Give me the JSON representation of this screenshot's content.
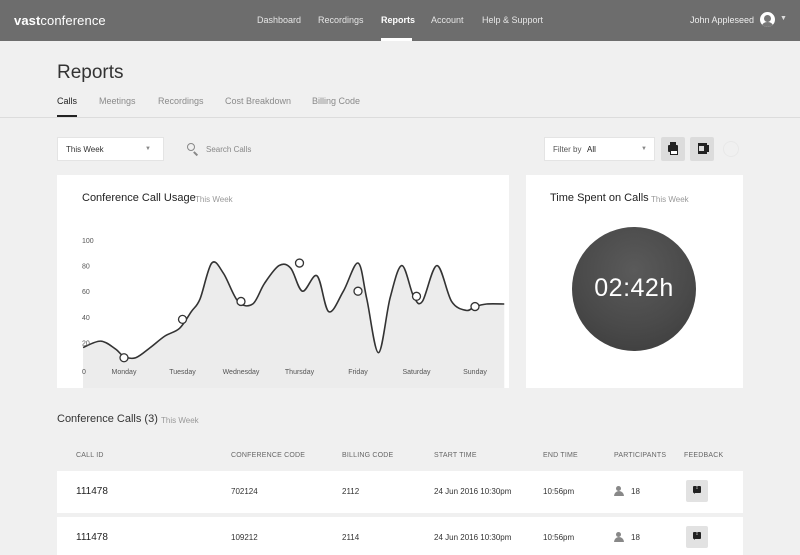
{
  "brand": {
    "prefix": "vast",
    "suffix": "conference"
  },
  "nav": {
    "items": [
      "Dashboard",
      "Recordings",
      "Reports",
      "Account",
      "Help & Support"
    ],
    "active": "Reports"
  },
  "user": {
    "name": "John Appleseed",
    "menu_icon": "chevron-down-icon"
  },
  "page": {
    "title": "Reports"
  },
  "subtabs": {
    "items": [
      "Calls",
      "Meetings",
      "Recordings",
      "Cost Breakdown",
      "Billing Code"
    ],
    "active": "Calls"
  },
  "filters": {
    "period": "This Week",
    "search_placeholder": "Search Calls",
    "filter_label": "Filter by",
    "filter_value": "All"
  },
  "usage_card": {
    "title": "Conference Call Usage",
    "subtitle": "This Week"
  },
  "chart_data": {
    "type": "line",
    "title": "Conference Call Usage",
    "subtitle": "This Week",
    "x_categories": [
      "Monday",
      "Tuesday",
      "Wednesday",
      "Thursday",
      "Friday",
      "Saturday",
      "Sunday"
    ],
    "y_ticks": [
      0,
      20,
      40,
      60,
      80,
      100
    ],
    "ylim": [
      0,
      100
    ],
    "grid": false,
    "series": [
      {
        "x": [
          -0.7,
          -0.4,
          -0.15,
          0,
          0.2,
          0.45,
          0.7,
          0.95,
          1.15,
          1.3,
          1.5,
          1.7,
          1.95,
          2.2,
          2.4,
          2.65,
          2.85,
          3.05,
          3.3,
          3.5,
          3.75,
          4.0,
          4.15,
          4.35,
          4.55,
          4.75,
          4.95,
          5.1,
          5.35,
          5.6,
          5.85,
          6.0,
          6.2,
          6.5
        ],
        "y": [
          16,
          21,
          15,
          9,
          8,
          16,
          25,
          31,
          44,
          54,
          82,
          74,
          52,
          50,
          66,
          80,
          78,
          60,
          72,
          44,
          60,
          82,
          54,
          12,
          55,
          80,
          56,
          52,
          80,
          52,
          45,
          48,
          50,
          50
        ]
      }
    ],
    "markers": [
      {
        "x": 0,
        "y": 8
      },
      {
        "x": 1,
        "y": 38
      },
      {
        "x": 2,
        "y": 52
      },
      {
        "x": 3,
        "y": 82
      },
      {
        "x": 4,
        "y": 60
      },
      {
        "x": 5,
        "y": 56
      },
      {
        "x": 6,
        "y": 48
      }
    ]
  },
  "time_card": {
    "title": "Time Spent on Calls",
    "subtitle": "This Week",
    "value": "02:42h"
  },
  "calls_table": {
    "title": "Conference Calls (3)",
    "subtitle": "This Week",
    "columns": [
      "CALL ID",
      "CONFERENCE CODE",
      "BILLING CODE",
      "START TIME",
      "END TIME",
      "PARTICIPANTS",
      "FEEDBACK"
    ],
    "rows": [
      {
        "call_id": "111478",
        "conference_code": "702124",
        "billing_code": "2112",
        "start_time": "24 Jun 2016 10:30pm",
        "end_time": "10:56pm",
        "participants": "18"
      },
      {
        "call_id": "111478",
        "conference_code": "109212",
        "billing_code": "2114",
        "start_time": "24 Jun 2016 10:30pm",
        "end_time": "10:56pm",
        "participants": "18"
      }
    ]
  }
}
